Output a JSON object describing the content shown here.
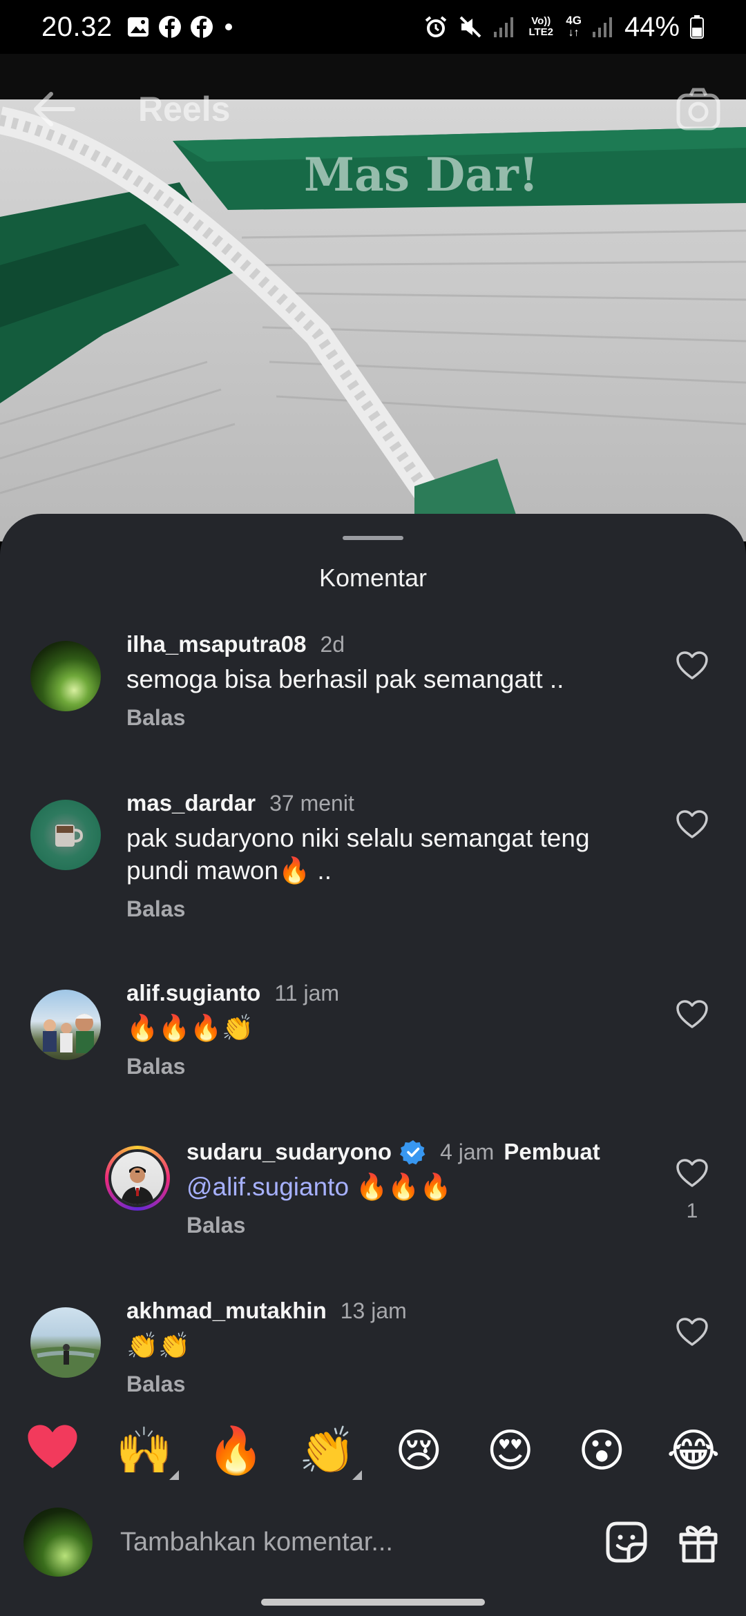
{
  "status_bar": {
    "time": "20.32",
    "left_icons": [
      "gallery-icon",
      "facebook-icon",
      "facebook-icon",
      "dot-icon"
    ],
    "right_icons": [
      "alarm-icon",
      "mute-icon",
      "signal-icon",
      "volte-icon",
      "4g-icon",
      "signal-icon",
      "battery-icon"
    ],
    "network_label": "Vo)) LTE2",
    "network_type": "4G",
    "battery": "44%"
  },
  "header": {
    "back_icon": "arrow-left-icon",
    "title": "Reels",
    "camera_icon": "camera-icon"
  },
  "video": {
    "watermark": "Mas Dar!"
  },
  "sheet": {
    "title": "Komentar"
  },
  "comments": [
    {
      "username": "ilha_msaputra08",
      "time": "2d",
      "text": "semoga bisa berhasil pak semangatt ..",
      "reply_label": "Balas",
      "avatar": "green-glow-avatar"
    },
    {
      "username": "mas_dardar",
      "time": "37 menit",
      "text": "pak sudaryono niki selalu semangat teng pundi mawon🔥 ..",
      "reply_label": "Balas",
      "avatar": "coffee-cup-avatar"
    },
    {
      "username": "alif.sugianto",
      "time": "11 jam",
      "text": "🔥🔥🔥👏",
      "reply_label": "Balas",
      "avatar": "group-photo-avatar"
    },
    {
      "username": "sudaru_sudaryono",
      "verified": true,
      "time": "4 jam",
      "badge": "Pembuat",
      "mention": "@alif.sugianto",
      "text": " 🔥🔥🔥",
      "reply_label": "Balas",
      "like_count": "1",
      "avatar": "portrait-avatar"
    },
    {
      "username": "akhmad_mutakhin",
      "time": "13 jam",
      "text": "👏👏",
      "reply_label": "Balas",
      "avatar": "outdoor-avatar"
    }
  ],
  "emoji_bar": [
    "❤️",
    "🙌",
    "🔥",
    "👏",
    "😢",
    "😍",
    "😮",
    "😂"
  ],
  "input": {
    "placeholder": "Tambahkan komentar...",
    "sticker_icon": "sticker-icon",
    "gift_icon": "gift-icon"
  },
  "colors": {
    "sheet_bg": "#24262b",
    "secondary_text": "#a8a9ad",
    "mention": "#a7b1ff",
    "verified": "#3897f0",
    "heart_emoji": "#f23a5c"
  }
}
